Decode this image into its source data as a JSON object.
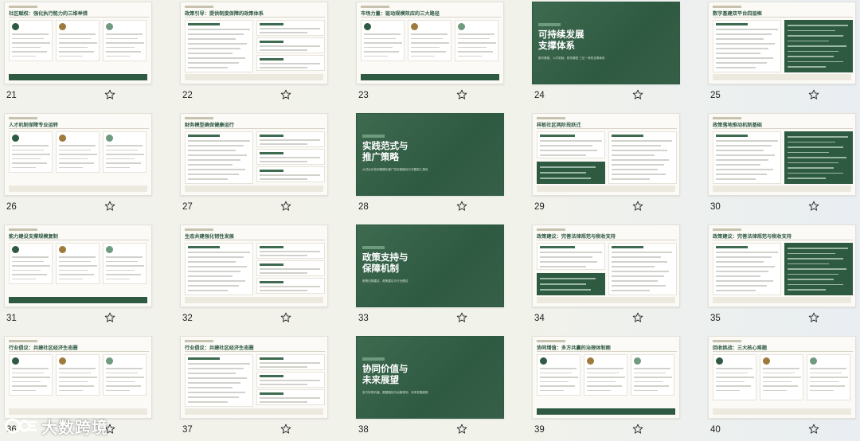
{
  "slides": [
    {
      "number": "21",
      "title": "社区赋权：强化执行能力的三维举措"
    },
    {
      "number": "22",
      "title": "政策引导：提供制度保障的政策体系"
    },
    {
      "number": "23",
      "title": "市场力量：驱动规模效应的三大路径"
    },
    {
      "number": "24",
      "title": "可持续发展\n支撑体系",
      "subtitle": "数字基座、人才机制、财务模型\n三位一体的支撑体系"
    },
    {
      "number": "25",
      "title": "数字基建双平台四层框"
    },
    {
      "number": "26",
      "title": "人才机制保障专业运转"
    },
    {
      "number": "27",
      "title": "财务模型确保健康运行"
    },
    {
      "number": "28",
      "title": "实践范式与\n推广策略",
      "subtitle": "从试点示范到规模化推广的实施路径与可复制工具包"
    },
    {
      "number": "29",
      "title": "样板社区两阶段跃迁"
    },
    {
      "number": "30",
      "title": "政策落地推动机制基础"
    },
    {
      "number": "31",
      "title": "能力建设支撑规模复制"
    },
    {
      "number": "32",
      "title": "生态共建强化韧性发展"
    },
    {
      "number": "33",
      "title": "政策支持与\n保障机制",
      "subtitle": "政策法规建议、政策建议与行业倡议"
    },
    {
      "number": "34",
      "title": "政策建议：完善法律规范与税收支持"
    },
    {
      "number": "35",
      "title": "政策建议：完善法律规范与税收支持"
    },
    {
      "number": "36",
      "title": "行业倡议：共建社区经济生态圈"
    },
    {
      "number": "37",
      "title": "行业倡议：共建社区经济生态圈"
    },
    {
      "number": "38",
      "title": "协同价值与\n未来展望",
      "subtitle": "多方协同价值、展望路径与远景规划、未来发展趋势"
    },
    {
      "number": "39",
      "title": "协同增值：多方共赢的治理体制图"
    },
    {
      "number": "40",
      "title": "回收挑战：三大核心难题"
    }
  ],
  "watermark": {
    "text": "大数跨境"
  },
  "colors": {
    "brand_green": "#2f5a42",
    "accent_sage": "#6e9a7e",
    "paper": "#fbfaf6"
  },
  "icons": {
    "favorite": "star-outline-icon"
  }
}
